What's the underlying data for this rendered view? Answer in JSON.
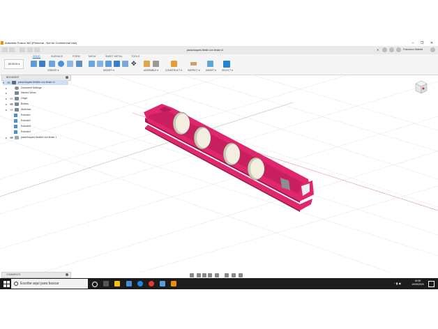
{
  "app": {
    "title": "Autodesk Fusion 360 (Personal - Not for Commercial Use)",
    "document_tab": "parachoques flexibi con fense v1",
    "user": "Francisco Mabels"
  },
  "ribbon": {
    "design_button": "DESIGN ▾",
    "tabs": [
      "SOLID",
      "SURFACE",
      "FORM",
      "MESH",
      "SHEET METAL",
      "TOOLS"
    ],
    "groups": [
      "CREATE ▾",
      "MODIFY ▾",
      "ASSEMBLE ▾",
      "CONSTRUCT ▾",
      "INSPECT ▾",
      "INSERT ▾",
      "SELECT ▾"
    ]
  },
  "browser": {
    "header": "BROWSER",
    "root": "parachoques flexible con fense v1",
    "items": [
      "Document Settings",
      "Named Views",
      "Origin",
      "Bodies",
      "Sketches",
      "Extrude1",
      "Extrude2",
      "Extrude3",
      "Extrude4",
      "parachoques flexible con fense 1"
    ]
  },
  "comments": {
    "header": "COMMENTS"
  },
  "taskbar": {
    "search_placeholder": "Escribe aquí para buscar",
    "time": "16:50",
    "date": "19/05/2020"
  },
  "colors": {
    "model": "#e0266d",
    "accent": "#0a6ecf"
  }
}
